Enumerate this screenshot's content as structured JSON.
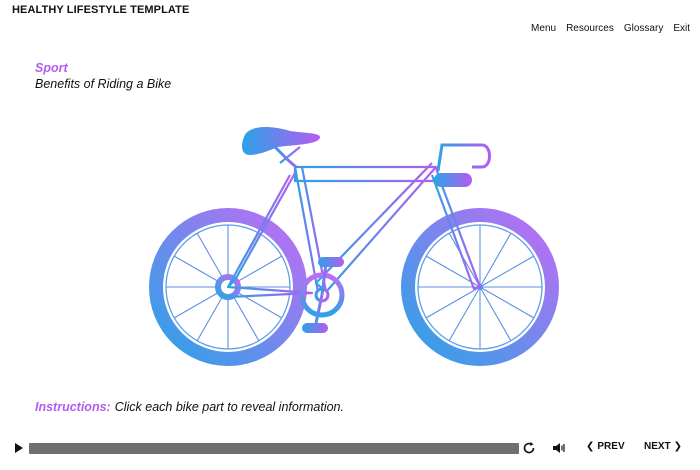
{
  "header": {
    "course_title": "HEALTHY LIFESTYLE TEMPLATE",
    "nav": [
      "Menu",
      "Resources",
      "Glossary",
      "Exit"
    ]
  },
  "slide": {
    "section_label": "Sport",
    "title": "Benefits of Riding a Bike",
    "instructions_lead": "Instructions:",
    "instructions_text": "Click each bike part to reveal information."
  },
  "player": {
    "prev_label": "PREV",
    "next_label": "NEXT",
    "progress": 0
  },
  "icons": {
    "play": "play-icon",
    "replay": "replay-icon",
    "volume": "volume-icon",
    "prev": "chevron-left-icon",
    "next": "chevron-right-icon"
  },
  "colors": {
    "accent_purple": "#b45cf2",
    "gradient_blue": "#2ba3e6",
    "gradient_purple": "#c06cf5",
    "seek_track": "#6f6f6f"
  }
}
